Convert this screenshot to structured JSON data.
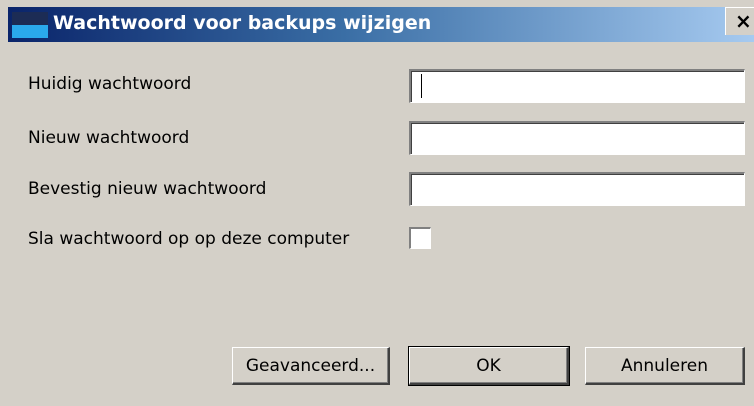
{
  "dialog": {
    "title": "Wachtwoord voor backups wijzigen",
    "close_glyph": "×"
  },
  "fields": {
    "current_password_label": "Huidig wachtwoord",
    "new_password_label": "Nieuw wachtwoord",
    "confirm_password_label": "Bevestig nieuw wachtwoord",
    "current_password_value": "",
    "new_password_value": "",
    "confirm_password_value": ""
  },
  "options": {
    "save_password_label": "Sla wachtwoord op op deze computer",
    "save_password_checked": false
  },
  "buttons": {
    "advanced": "Geavanceerd...",
    "ok": "OK",
    "cancel": "Annuleren"
  },
  "colors": {
    "dialog_bg": "#d4d0c8",
    "title_gradient_start": "#0a246a",
    "title_gradient_end": "#a6caf0"
  }
}
